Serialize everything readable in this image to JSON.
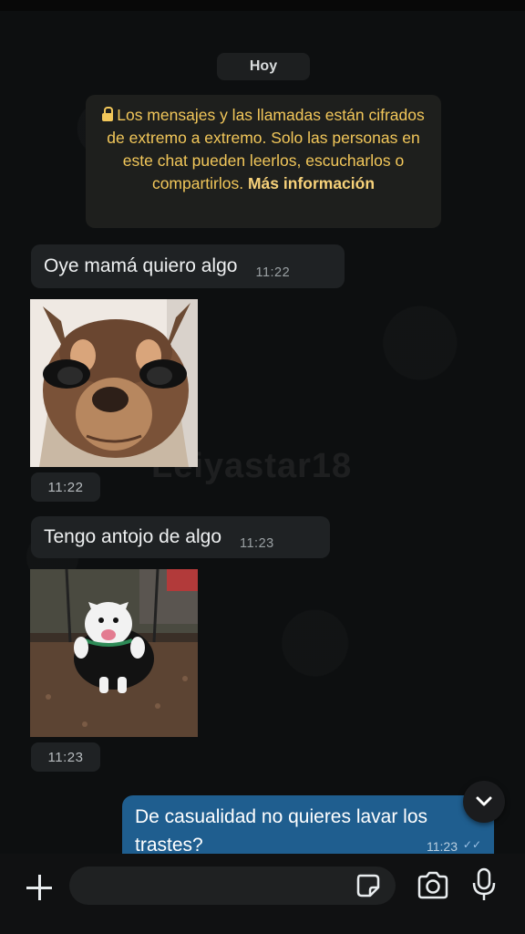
{
  "chat": {
    "date_chip": "Hoy",
    "encryption": {
      "text": "Los mensajes y las llamadas están cifrados de extremo a extremo. Solo las personas en este chat pueden leerlos, escucharlos o compartirlos.",
      "link": "Más información"
    },
    "messages": [
      {
        "type": "text",
        "direction": "in",
        "text": "Oye mamá quiero algo",
        "time": "11:22"
      },
      {
        "type": "sticker",
        "direction": "in",
        "sticker": "chihuahua-eyelashes",
        "time": "11:22"
      },
      {
        "type": "text",
        "direction": "in",
        "text": "Tengo antojo de algo",
        "time": "11:23"
      },
      {
        "type": "sticker",
        "direction": "in",
        "sticker": "bulldog-swing",
        "time": "11:23"
      },
      {
        "type": "text",
        "direction": "out",
        "text": "De casualidad no quieres lavar los trastes?",
        "time": "11:23",
        "status": "read"
      }
    ],
    "watermark": "Leiyastar18"
  },
  "composer": {
    "placeholder": "",
    "icons": [
      "plus-icon",
      "sticker-icon",
      "camera-icon",
      "mic-icon"
    ]
  },
  "colors": {
    "background": "#0d0f10",
    "bubble_in": "#1f2224",
    "bubble_out": "#1f5e8f",
    "encryption_text": "#f2c75a"
  }
}
